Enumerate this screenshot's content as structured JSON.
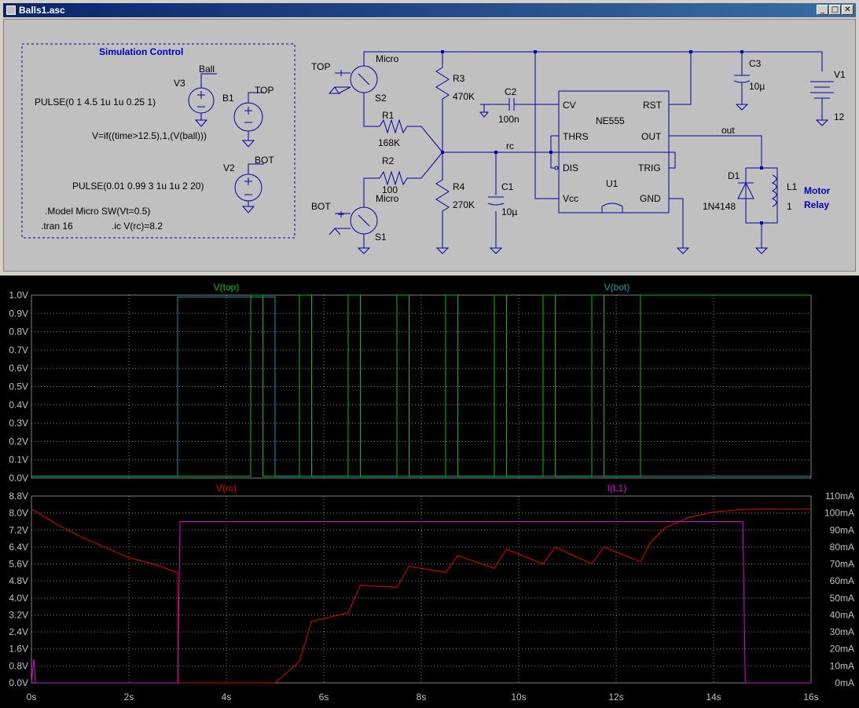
{
  "window": {
    "title": "Balls1.asc",
    "minimize_label": "_",
    "maximize_label": "□",
    "close_label": "✕"
  },
  "schematic": {
    "sim_control_title": "Simulation Control",
    "V3": {
      "name": "V3",
      "net": "Ball",
      "value": "PULSE(0 1 4.5 1u 1u 0.25 1)"
    },
    "B1": {
      "name": "B1",
      "net": "TOP",
      "expr": "V=if((time>12.5),1,(V(ball)))"
    },
    "V2": {
      "name": "V2",
      "net": "BOT",
      "value": "PULSE(0.01 0.99 3 1u 1u 2 20)"
    },
    "model": ".Model Micro SW(Vt=0.5)",
    "tran": ".tran 16",
    "ic": ".ic V(rc)=8.2",
    "S2": {
      "name": "S2",
      "model": "Micro",
      "label": "TOP"
    },
    "S1": {
      "name": "S1",
      "model": "Micro",
      "label": "BOT"
    },
    "R1": {
      "name": "R1",
      "value": "168K"
    },
    "R2": {
      "name": "R2",
      "value": "100"
    },
    "R3": {
      "name": "R3",
      "value": "470K"
    },
    "R4": {
      "name": "R4",
      "value": "270K"
    },
    "C1": {
      "name": "C1",
      "value": "10µ"
    },
    "C2": {
      "name": "C2",
      "value": "100n"
    },
    "C3": {
      "name": "C3",
      "value": "10µ"
    },
    "V1": {
      "name": "V1",
      "value": "12"
    },
    "U1": {
      "name": "U1",
      "part": "NE555",
      "pins": {
        "cv": "CV",
        "thrs": "THRS",
        "dis": "DIS",
        "vcc": "Vcc",
        "rst": "RST",
        "out": "OUT",
        "trig": "TRIG",
        "gnd": "GND"
      }
    },
    "D1": {
      "name": "D1",
      "value": "1N4148"
    },
    "L1": {
      "name": "L1",
      "value": "1"
    },
    "net_rc": "rc",
    "net_out": "out",
    "motor_label_1": "Motor",
    "motor_label_2": "Relay"
  },
  "colors": {
    "top": "#00c000",
    "bot": "#00a0a0",
    "rc": "#e00000",
    "il1": "#e000e0",
    "wire": "#0000a0",
    "text": "#000080"
  },
  "chart_data": [
    {
      "type": "line",
      "title": "",
      "xlabel": "",
      "ylabel": "",
      "xlim": [
        0,
        16
      ],
      "ylim": [
        0,
        1.0
      ],
      "x_ticks": [
        "0s",
        "2s",
        "4s",
        "6s",
        "8s",
        "10s",
        "12s",
        "14s",
        "16s"
      ],
      "y_ticks": [
        "0.0V",
        "0.1V",
        "0.2V",
        "0.3V",
        "0.4V",
        "0.5V",
        "0.6V",
        "0.7V",
        "0.8V",
        "0.9V",
        "1.0V"
      ],
      "grid": true,
      "series": [
        {
          "name": "V(top)",
          "color": "#00c000",
          "x": [
            0,
            4.5,
            4.5,
            4.75,
            4.75,
            5.5,
            5.5,
            5.75,
            5.75,
            6.5,
            6.5,
            6.75,
            6.75,
            7.5,
            7.5,
            7.75,
            7.75,
            8.5,
            8.5,
            8.75,
            8.75,
            9.5,
            9.5,
            9.75,
            9.75,
            10.5,
            10.5,
            10.75,
            10.75,
            11.5,
            11.5,
            11.75,
            11.75,
            12.5,
            12.5,
            16
          ],
          "y": [
            0.01,
            0.01,
            1,
            1,
            0.01,
            0.01,
            1,
            1,
            0.01,
            0.01,
            1,
            1,
            0.01,
            0.01,
            1,
            1,
            0.01,
            0.01,
            1,
            1,
            0.01,
            0.01,
            1,
            1,
            0.01,
            0.01,
            1,
            1,
            0.01,
            0.01,
            1,
            1,
            0.01,
            0.01,
            1,
            1
          ]
        },
        {
          "name": "V(bot)",
          "color": "#00a0a0",
          "x": [
            0,
            3,
            3,
            5,
            5,
            16
          ],
          "y": [
            0.01,
            0.01,
            0.99,
            0.99,
            0.01,
            0.01
          ]
        }
      ]
    },
    {
      "type": "line",
      "title": "",
      "xlabel": "",
      "ylabel": "",
      "xlim": [
        0,
        16
      ],
      "ylim": [
        0,
        8.8
      ],
      "y2lim": [
        0,
        110
      ],
      "x_ticks": [
        "0s",
        "2s",
        "4s",
        "6s",
        "8s",
        "10s",
        "12s",
        "14s",
        "16s"
      ],
      "y_ticks": [
        "0.0V",
        "0.8V",
        "1.6V",
        "2.4V",
        "3.2V",
        "4.0V",
        "4.8V",
        "5.6V",
        "6.4V",
        "7.2V",
        "8.0V",
        "8.8V"
      ],
      "y2_ticks": [
        "0mA",
        "10mA",
        "20mA",
        "30mA",
        "40mA",
        "50mA",
        "60mA",
        "70mA",
        "80mA",
        "90mA",
        "100mA",
        "110mA"
      ],
      "grid": true,
      "series": [
        {
          "name": "V(rc)",
          "color": "#e00000",
          "axis": "left",
          "x": [
            0,
            0.5,
            1,
            1.5,
            2,
            2.5,
            3,
            3.01,
            5,
            5.5,
            5.75,
            6.5,
            6.75,
            7.5,
            7.75,
            8.5,
            8.75,
            9.5,
            9.75,
            10.5,
            10.75,
            11.5,
            11.75,
            12.5,
            12.7,
            13,
            13.5,
            14,
            14.5,
            15,
            15.5,
            16
          ],
          "y": [
            8.2,
            7.5,
            6.9,
            6.4,
            5.9,
            5.6,
            5.2,
            0,
            0,
            1,
            2.9,
            3.3,
            4.6,
            4.5,
            5.5,
            5.2,
            6.0,
            5.4,
            6.3,
            5.6,
            6.4,
            5.6,
            6.4,
            5.7,
            6.6,
            7.3,
            7.8,
            8.05,
            8.15,
            8.2,
            8.2,
            8.2
          ]
        },
        {
          "name": "I(L1)",
          "color": "#e000e0",
          "axis": "right",
          "x": [
            0,
            0.05,
            0.08,
            3,
            3.05,
            14.6,
            14.65,
            16
          ],
          "y": [
            0,
            14,
            0,
            0,
            95,
            95,
            0,
            0
          ]
        }
      ]
    }
  ]
}
